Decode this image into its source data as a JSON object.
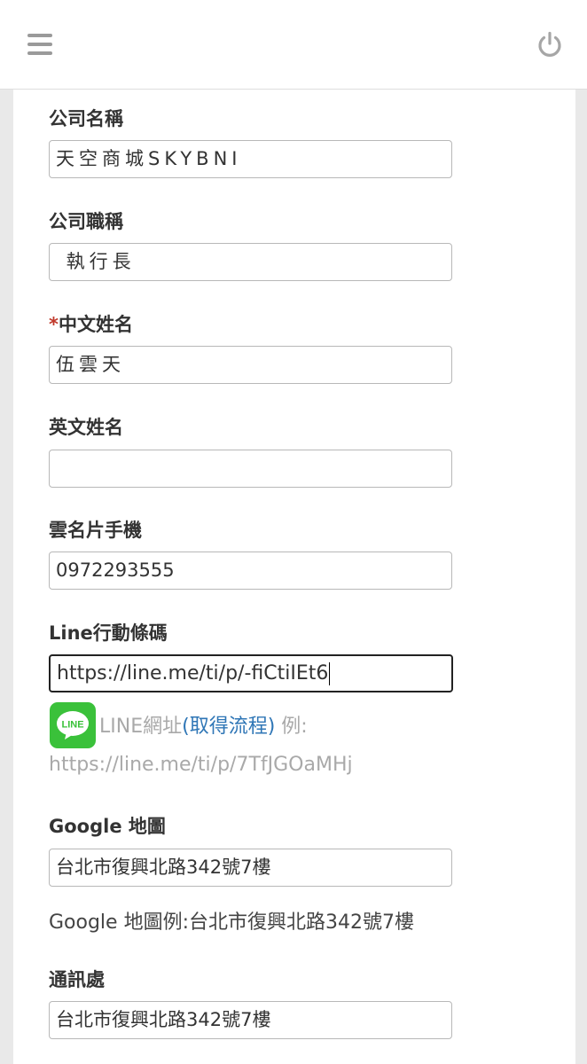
{
  "header": {
    "menu_icon": "hamburger-menu-icon",
    "power_icon": "power-icon"
  },
  "form": {
    "company_name": {
      "label": "公司名稱",
      "value": "天空商城SKYBNI"
    },
    "company_title": {
      "label": "公司職稱",
      "value": " 執行長"
    },
    "chinese_name": {
      "required_mark": "*",
      "label": "中文姓名",
      "value": "伍雲天"
    },
    "english_name": {
      "label": "英文姓名",
      "value": ""
    },
    "mobile": {
      "label": "雲名片手機",
      "value": "0972293555"
    },
    "line_code": {
      "label": "Line行動條碼",
      "value": "https://line.me/ti/p/-fiCtiIEt6",
      "hint_prefix": "LINE網址",
      "hint_link": "(取得流程)",
      "hint_suffix": " 例:",
      "example": "https://line.me/ti/p/7TfJGOaMHj",
      "icon": "line-app-icon",
      "icon_text": "LINE"
    },
    "google_map": {
      "label": "Google 地圖",
      "value": "台北市復興北路342號7樓",
      "example": "Google 地圖例:台北市復興北路342號7樓"
    },
    "address": {
      "label": "通訊處",
      "value": "台北市復興北路342號7樓"
    }
  },
  "colors": {
    "accent_link": "#2f76b6",
    "required": "#c0392b",
    "line_green": "#3ac13a"
  }
}
